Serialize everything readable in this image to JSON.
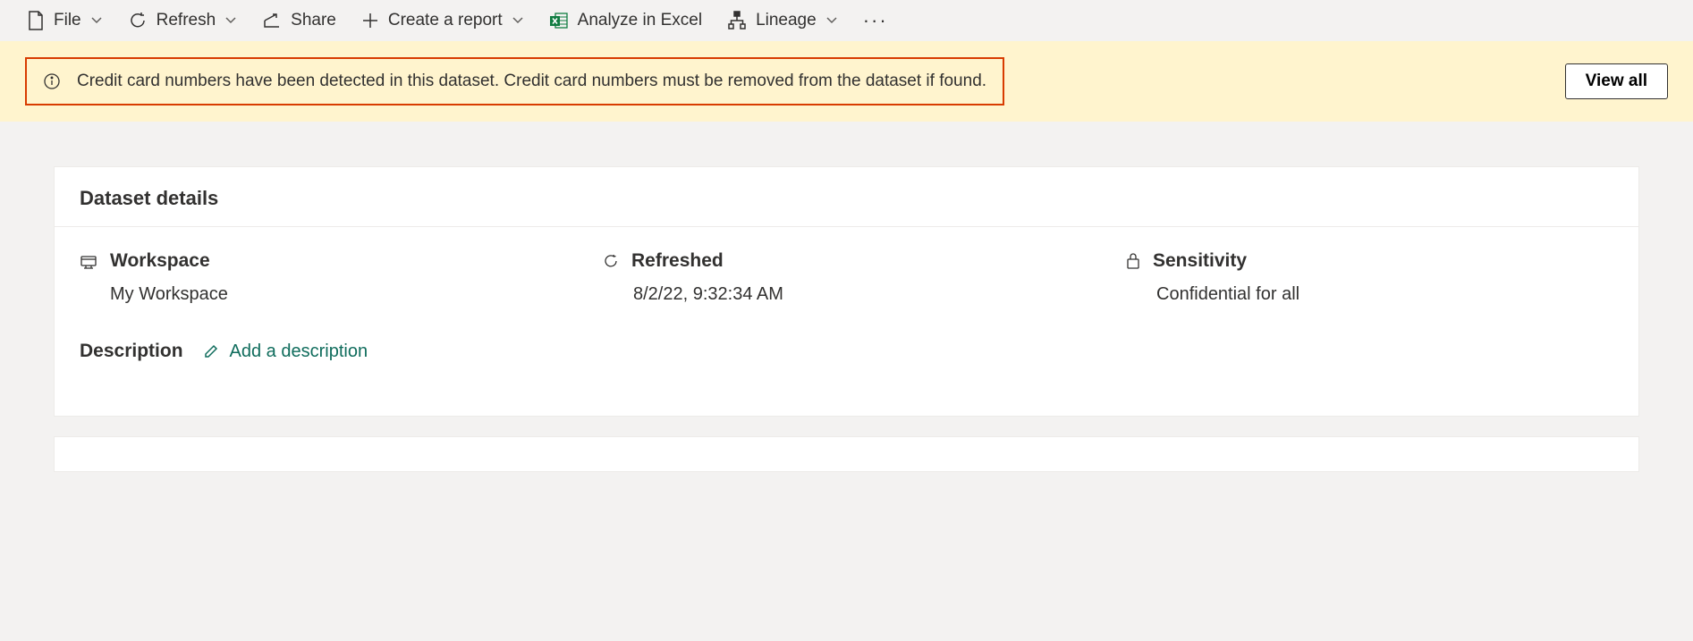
{
  "toolbar": {
    "file": "File",
    "refresh": "Refresh",
    "share": "Share",
    "create_report": "Create a report",
    "analyze_excel": "Analyze in Excel",
    "lineage": "Lineage"
  },
  "alert": {
    "message": "Credit card numbers have been detected in this dataset. Credit card numbers must be removed from the dataset if found.",
    "view_all": "View all"
  },
  "details": {
    "section_title": "Dataset details",
    "workspace_label": "Workspace",
    "workspace_value": "My Workspace",
    "refreshed_label": "Refreshed",
    "refreshed_value": "8/2/22, 9:32:34 AM",
    "sensitivity_label": "Sensitivity",
    "sensitivity_value": "Confidential for all",
    "description_label": "Description",
    "add_description": "Add a description"
  }
}
